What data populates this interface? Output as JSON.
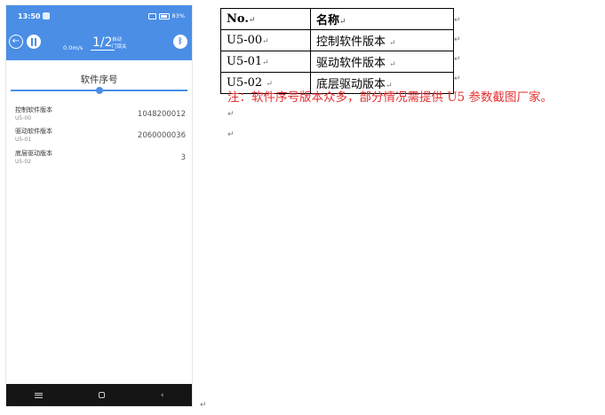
{
  "phone": {
    "status": {
      "time": "13:50",
      "battery": "83%"
    },
    "header": {
      "back_icon": "back-arrow-circle-icon",
      "elevator_icon": "elevator-doors-icon",
      "speed": "0.0m/s",
      "floor": "1/2",
      "mode_line1": "自动",
      "mode_line2": "门锁关",
      "bluetooth_icon": "bluetooth-icon"
    },
    "page_title": "软件序号",
    "slider_value": 0.5,
    "rows": [
      {
        "label": "控制软件版本",
        "code": "U5-00",
        "value": "1048200012"
      },
      {
        "label": "驱动软件版本",
        "code": "U5-01",
        "value": "2060000036"
      },
      {
        "label": "底层驱动版本",
        "code": "U5-02",
        "value": "3"
      }
    ],
    "navbar": {
      "menu_icon": "menu-icon",
      "home_icon": "home-icon",
      "back_icon": "back-chevron-icon"
    }
  },
  "doc": {
    "table": {
      "headers": [
        "No.",
        "名称"
      ],
      "rows": [
        [
          "U5-00",
          "控制软件版本"
        ],
        [
          "U5-01",
          "驱动软件版本"
        ],
        [
          "U5-02",
          "底层驱动版本"
        ]
      ]
    },
    "note": "注：软件序号版本众多，部分情况需提供 U5 参数截图厂家。",
    "colors": {
      "note": "#e53030",
      "accent": "#4a8ee6"
    }
  }
}
